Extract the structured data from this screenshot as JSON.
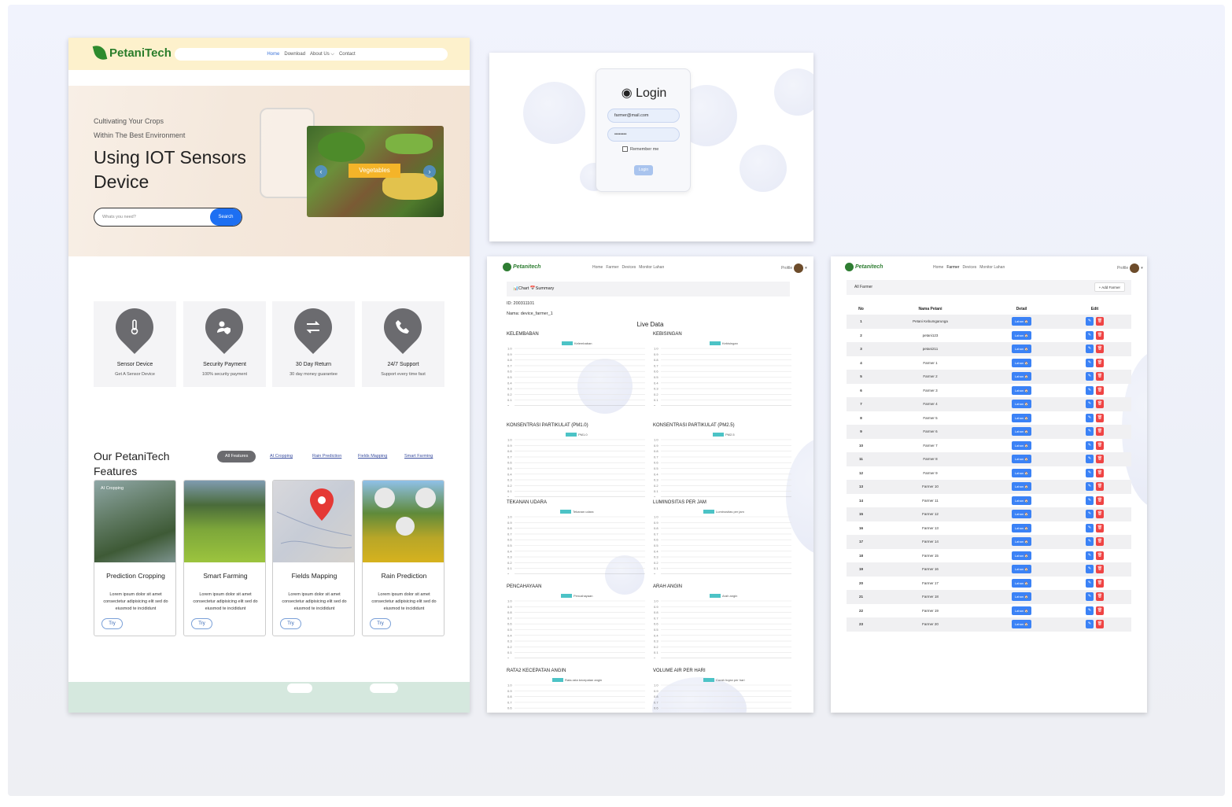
{
  "landing": {
    "brand": "PetaniTech",
    "nav": [
      "Home",
      "Download",
      "About Us ⌵",
      "Contact"
    ],
    "hero_sub1": "Cultivating Your Crops",
    "hero_sub2": "Within The Best Environment",
    "hero_title": "Using IOT Sensors Device",
    "search_placeholder": "Whats you need?",
    "search_button": "Search",
    "carousel_label": "Vegetables",
    "features": [
      {
        "icon": "thermometer-icon",
        "title": "Sensor Device",
        "desc": "Get A Sensor Device"
      },
      {
        "icon": "user-shield-icon",
        "title": "Security Payment",
        "desc": "100% security payment"
      },
      {
        "icon": "exchange-icon",
        "title": "30 Day Return",
        "desc": "30 day money guarantee"
      },
      {
        "icon": "phone-icon",
        "title": "24/7 Support",
        "desc": "Support every time fast"
      }
    ],
    "our_title": "Our PetaniTech Features",
    "filters": [
      "All Features",
      "AI Cropping",
      "Rain Prediction",
      "Fields Mapping",
      "Smart Farming"
    ],
    "products": [
      {
        "tag": "AI Cropping",
        "title": "Prediction Cropping",
        "desc": "Lorem ipsum dolor sit amet consectetur adipisicing elit sed do eiusmod te incididunt",
        "button": "Try"
      },
      {
        "tag": "",
        "title": "Smart Farming",
        "desc": "Lorem ipsum dolor sit amet consectetur adipisicing elit sed do eiusmod te incididunt",
        "button": "Try"
      },
      {
        "tag": "",
        "title": "Fields Mapping",
        "desc": "Lorem ipsum dolor sit amet consectetur adipisicing elit sed do eiusmod te incididunt",
        "button": "Try"
      },
      {
        "tag": "",
        "title": "Rain Prediction",
        "desc": "Lorem ipsum dolor sit amet consectetur adipisicing elit sed do eiusmod te incididunt",
        "button": "Try"
      }
    ]
  },
  "login": {
    "title": "Login",
    "email_value": "farmer@mail.com",
    "password_value": "••••••••",
    "remember_label": "Remember me",
    "button": "Login"
  },
  "dashboard": {
    "brand": "Petanitech",
    "nav": [
      "Home",
      "Farmer",
      "Devices",
      "Monitor Lahan"
    ],
    "profile": "Profile",
    "tabs": "📊Chart  📅Summary",
    "device_id": "ID: 200311101",
    "device_name": "Nama: device_farmer_1",
    "live_title": "Live Data",
    "charts": [
      {
        "title": "KELEMBABAN",
        "legend": "Kelembaban"
      },
      {
        "title": "KEBISINGAN",
        "legend": "Kebisingan"
      },
      {
        "title": "KONSENTRASI PARTIKULAT (PM1.0)",
        "legend": "PM1.0"
      },
      {
        "title": "KONSENTRASI PARTIKULAT (PM2.5)",
        "legend": "PM2.5"
      },
      {
        "title": "TEKANAN UDARA",
        "legend": "Tekanan udara"
      },
      {
        "title": "LUMINOSITAS PER JAM",
        "legend": "Luminositas per jam"
      },
      {
        "title": "PENCAHAYAAN",
        "legend": "Pencahayaan"
      },
      {
        "title": "ARAH ANGIN",
        "legend": "Arah angin"
      },
      {
        "title": "RATA2 KECEPATAN ANGIN",
        "legend": "Rata-rata kecepatan angin"
      },
      {
        "title": "VOLUME AIR PER HARI",
        "legend": "Curah hujan per hari"
      }
    ],
    "y_ticks": [
      "1.0",
      "0.9",
      "0.8",
      "0.7",
      "0.6",
      "0.5",
      "0.4",
      "0.3",
      "0.2",
      "0.1",
      "0"
    ]
  },
  "farmers": {
    "brand": "Petanitech",
    "nav": [
      "Home",
      "Farmer",
      "Devices",
      "Monitor Lahan"
    ],
    "profile": "Profile",
    "section_title": "All Farmer",
    "add_button": "+ Add Farmer",
    "headers": [
      "No",
      "Nama Petani",
      "Detail",
      "Edit"
    ],
    "detail_label": "Lahan 🏠",
    "rows": [
      {
        "no": "1",
        "name": "Petani Kebumgarunga"
      },
      {
        "no": "2",
        "name": "petani123"
      },
      {
        "no": "3",
        "name": "petani211"
      },
      {
        "no": "4",
        "name": "Farmer 1"
      },
      {
        "no": "5",
        "name": "Farmer 2"
      },
      {
        "no": "6",
        "name": "Farmer 3"
      },
      {
        "no": "7",
        "name": "Farmer 4"
      },
      {
        "no": "8",
        "name": "Farmer 5"
      },
      {
        "no": "9",
        "name": "Farmer 6"
      },
      {
        "no": "10",
        "name": "Farmer 7"
      },
      {
        "no": "11",
        "name": "Farmer 8"
      },
      {
        "no": "12",
        "name": "Farmer 9"
      },
      {
        "no": "13",
        "name": "Farmer 10"
      },
      {
        "no": "14",
        "name": "Farmer 11"
      },
      {
        "no": "15",
        "name": "Farmer 12"
      },
      {
        "no": "16",
        "name": "Farmer 13"
      },
      {
        "no": "17",
        "name": "Farmer 14"
      },
      {
        "no": "18",
        "name": "Farmer 15"
      },
      {
        "no": "19",
        "name": "Farmer 16"
      },
      {
        "no": "20",
        "name": "Farmer 17"
      },
      {
        "no": "21",
        "name": "Farmer 18"
      },
      {
        "no": "22",
        "name": "Farmer 19"
      },
      {
        "no": "23",
        "name": "Farmer 20"
      }
    ]
  },
  "colors": {
    "brand_green": "#2e7d32",
    "primary_blue": "#3b82f6",
    "danger_red": "#ef4444",
    "chart_teal": "#4cc3c6"
  }
}
